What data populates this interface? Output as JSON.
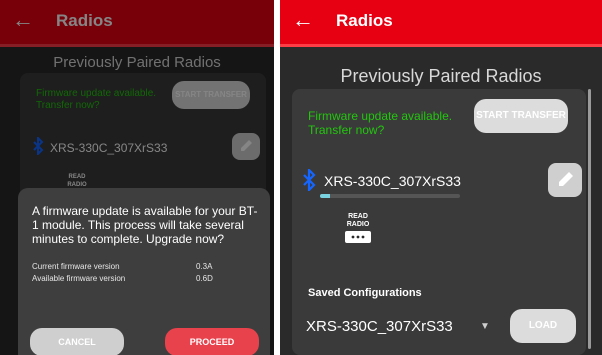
{
  "app": {
    "title": "Radios",
    "heading": "Previously Paired Radios"
  },
  "firmware": {
    "notice": "Firmware update available. Transfer now?",
    "transfer_label": "START TRANSFER"
  },
  "radio": {
    "name": "XRS-330C_307XrS33",
    "read_label_line1": "READ",
    "read_label_line2": "RADIO",
    "transfer_progress": 0.07
  },
  "saved_configurations": {
    "heading": "Saved Configurations",
    "selected": "XRS-330C_307XrS33",
    "load_label": "LOAD"
  },
  "dialog": {
    "message": "A firmware update is available for your BT-1 module. This process will take several minutes to complete. Upgrade now?",
    "current_label": "Current firmware version",
    "current_value": "0.3A",
    "available_label": "Available firmware version",
    "available_value": "0.6D",
    "cancel_label": "CANCEL",
    "proceed_label": "PROCEED"
  },
  "colors": {
    "app_bar": "#e60012",
    "firmware_text": "#22c60e",
    "proceed_button": "#e8424c",
    "bluetooth": "#1565ff"
  },
  "icons": [
    "back-arrow-icon",
    "bluetooth-icon",
    "pencil-icon",
    "read-radio-icon",
    "dropdown-caret-icon"
  ]
}
